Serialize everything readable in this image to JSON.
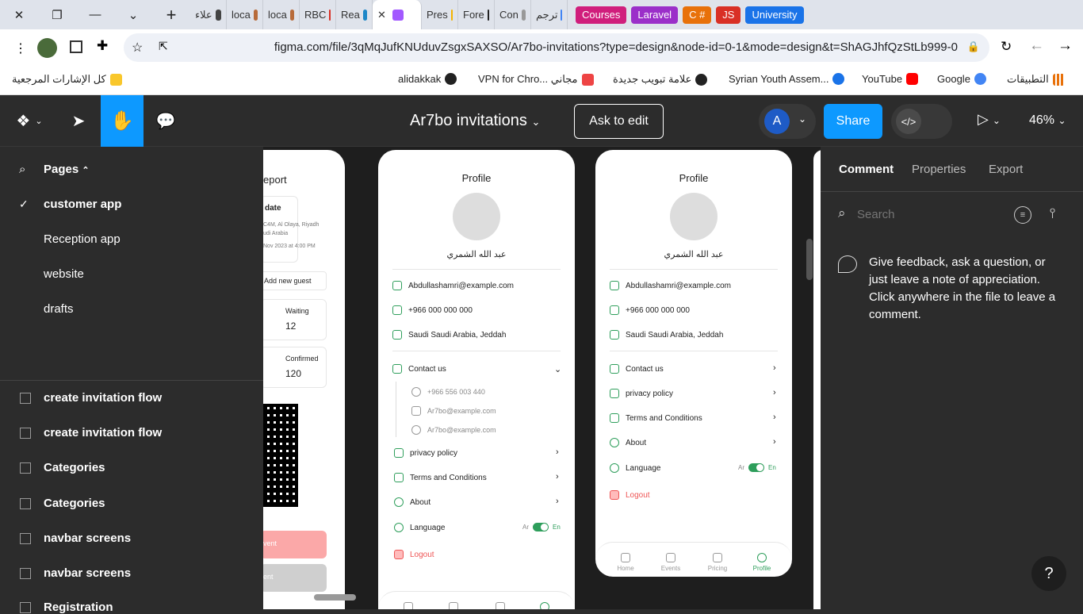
{
  "browser": {
    "tabs": [
      {
        "label": "علاء",
        "color": "#444"
      },
      {
        "label": "loca",
        "color": "#b86b3a"
      },
      {
        "label": "loca",
        "color": "#b86b3a"
      },
      {
        "label": "RBC",
        "color": "#d93025"
      },
      {
        "label": "Rea",
        "color": "#1e88c8"
      },
      {
        "label": "",
        "color": "#a259ff"
      },
      {
        "label": "Pres",
        "color": "#f4b400"
      },
      {
        "label": "Fore",
        "color": "#222"
      },
      {
        "label": "Con",
        "color": "#999"
      },
      {
        "label": "ترجم",
        "color": "#4285f4"
      }
    ],
    "groups": [
      {
        "label": "Courses",
        "color": "#d01e7c"
      },
      {
        "label": "Laravel",
        "color": "#9b2fc9"
      },
      {
        "label": "C #",
        "color": "#e8710a"
      },
      {
        "label": "JS",
        "color": "#d93025"
      },
      {
        "label": "University",
        "color": "#1a73e8"
      }
    ],
    "url": "figma.com/file/3qMqJufKNUduvZsgxSAXSO/Ar7bo-invitations?type=design&node-id=0-1&mode=design&t=ShAGJhfQzStLb999-0",
    "bookmarks": [
      {
        "label": "كل الإشارات المرجعية",
        "color": "#f9c72b"
      },
      {
        "label": "alidakkak",
        "color": "#222"
      },
      {
        "label": "VPN for Chro... مجاني",
        "color": "#e44"
      },
      {
        "label": "علامة تبويب جديدة",
        "color": "#222"
      },
      {
        "label": "Syrian Youth Assem...",
        "color": "#1a73e8"
      },
      {
        "label": "YouTube",
        "color": "#ff0000"
      },
      {
        "label": "Google",
        "color": "#4285f4"
      },
      {
        "label": "التطبيقات",
        "color": "#e8710a"
      }
    ]
  },
  "figma": {
    "file_title": "Ar7bo invitations",
    "ask_edit": "Ask to edit",
    "avatar_letter": "A",
    "share": "Share",
    "zoom": "46%",
    "pages_title": "Pages",
    "pages": [
      "customer app",
      "Reception app",
      "website",
      "drafts"
    ],
    "layers": [
      "create invitation flow",
      "create invitation flow",
      "Categories",
      "Categories",
      "navbar screens",
      "navbar screens",
      "Registration"
    ],
    "right_tabs": [
      "Comment",
      "Properties",
      "Export"
    ],
    "search_placeholder": "Search",
    "comment_hint": "Give feedback, ask a question, or just leave a note of appreciation. Click anywhere in the file to leave a comment.",
    "help": "?"
  },
  "frame_left": {
    "title": "eport",
    "date_label": "date",
    "address": "C4M, Al Olaya, Riyadh",
    "address2": "udi Arabia",
    "when": "Nov 2023 at 4:00 PM",
    "add_guest": "Add new guest",
    "waiting_label": "Waiting",
    "waiting": "12",
    "confirmed_label": "Confirmed",
    "confirmed": "120",
    "btn1": "vent",
    "btn2": "ent"
  },
  "profile": {
    "title": "Profile",
    "name": "عبد الله الشمري",
    "email": "Abdullashamri@example.com",
    "phone": "+966 000 000 000",
    "location": "Saudi Saudi Arabia, Jeddah",
    "contact": "Contact us",
    "c_phone": "+966 556 003 440",
    "c_mail": "Ar7bo@example.com",
    "c_fb": "Ar7bo@example.com",
    "privacy": "privacy policy",
    "terms": "Terms and Conditions",
    "about": "About",
    "language": "Language",
    "lang_ar": "Ar",
    "lang_en": "En",
    "logout": "Logout",
    "nav": [
      "Home",
      "Events",
      "Pricing",
      "Profile"
    ]
  }
}
